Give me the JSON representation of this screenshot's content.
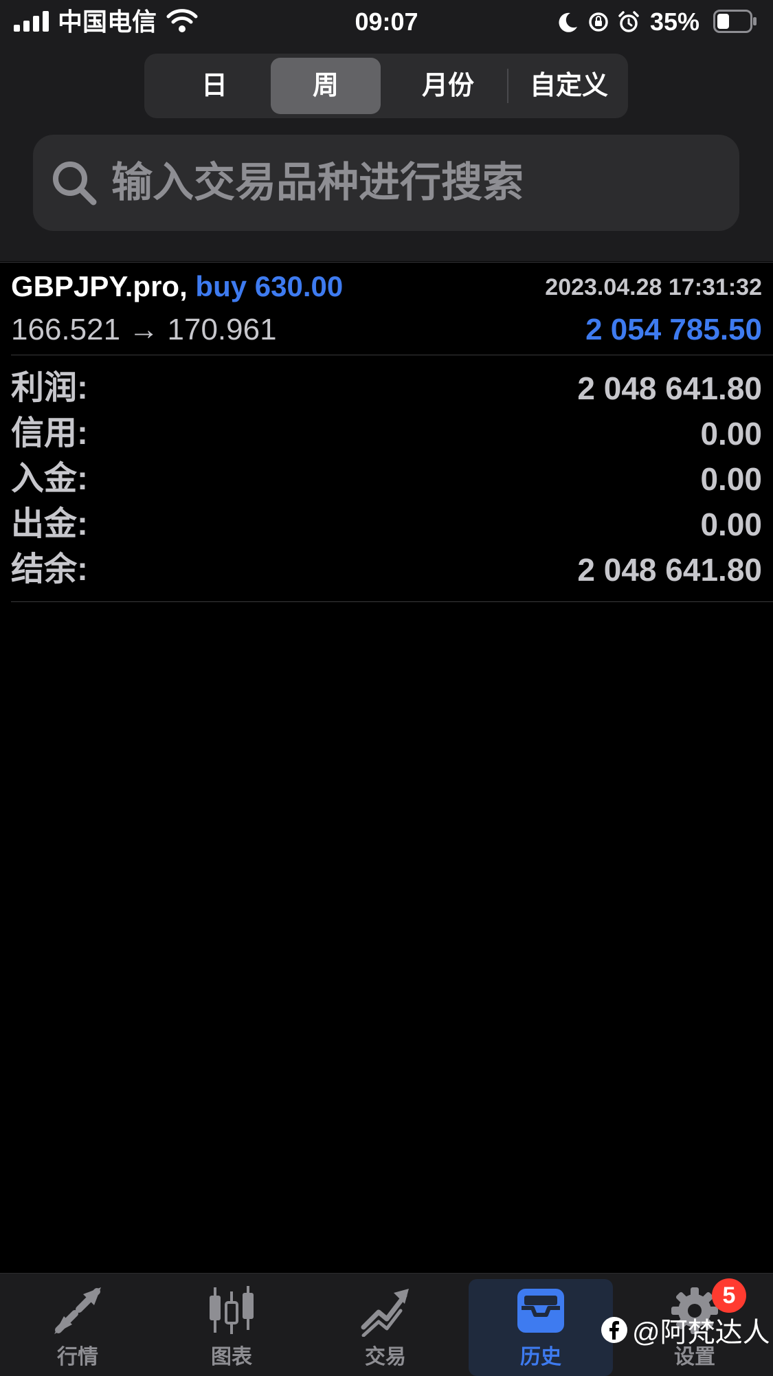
{
  "status_bar": {
    "carrier": "中国电信",
    "time": "09:07",
    "battery": "35%"
  },
  "period_tabs": [
    "日",
    "周",
    "月份",
    "自定义"
  ],
  "active_period": "周",
  "search": {
    "placeholder": "输入交易品种进行搜索"
  },
  "deal": {
    "symbol": "GBPJPY.pro,",
    "type_volume": "buy 630.00",
    "datetime": "2023.04.28 17:31:32",
    "prices": "166.521 → 170.961",
    "profit": "2 054 785.50"
  },
  "summary": [
    {
      "label": "利润:",
      "value": "2 048 641.80"
    },
    {
      "label": "信用:",
      "value": "0.00"
    },
    {
      "label": "入金:",
      "value": "0.00"
    },
    {
      "label": "出金:",
      "value": "0.00"
    },
    {
      "label": "结余:",
      "value": "2 048 641.80"
    }
  ],
  "tabbar": {
    "items": [
      {
        "label": "行情",
        "icon": "quotes-arrows-icon"
      },
      {
        "label": "图表",
        "icon": "candlestick-chart-icon"
      },
      {
        "label": "交易",
        "icon": "trade-trend-icon"
      },
      {
        "label": "历史",
        "icon": "history-inbox-icon"
      },
      {
        "label": "设置",
        "icon": "settings-gear-icon"
      }
    ],
    "active": "历史",
    "settings_badge": "5"
  },
  "watermark": "@阿梵达人",
  "colors": {
    "accent": "#3e7bf0",
    "background": "#000000",
    "panel": "#1c1c1e"
  }
}
